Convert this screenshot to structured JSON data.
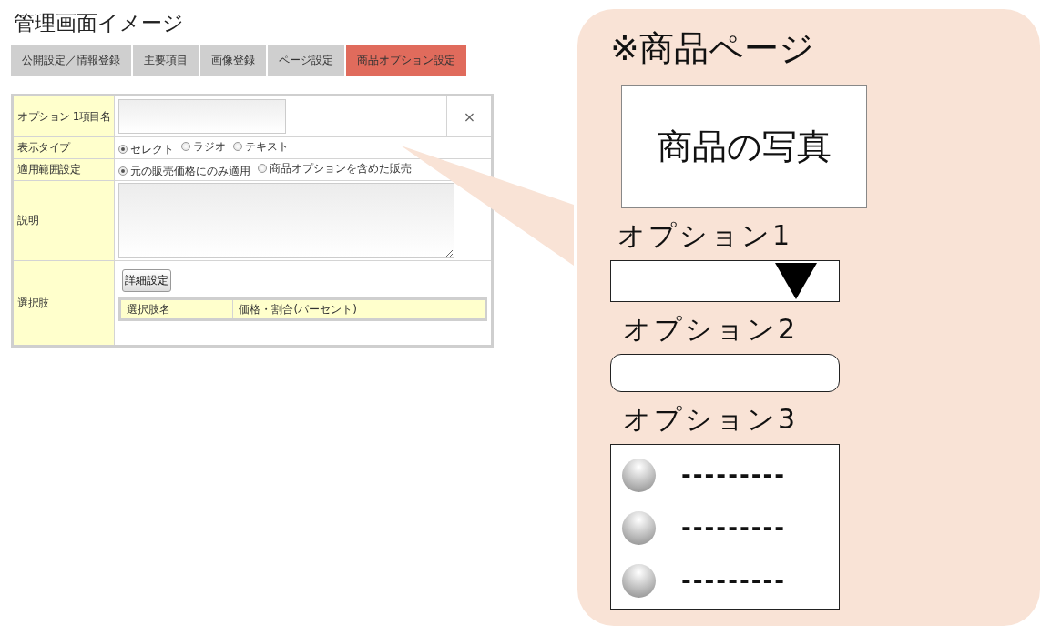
{
  "admin": {
    "title": "管理画面イメージ",
    "tabs": [
      {
        "label": "公開設定／情報登録",
        "selected": false
      },
      {
        "label": "主要項目",
        "selected": false
      },
      {
        "label": "画像登録",
        "selected": false
      },
      {
        "label": "ページ設定",
        "selected": false
      },
      {
        "label": "商品オプション設定",
        "selected": true
      }
    ],
    "rows": [
      {
        "kind": "text",
        "label": "オプション 1項目名",
        "close": "×"
      },
      {
        "kind": "radio",
        "label": "表示タイプ",
        "options": [
          {
            "label": "セレクト",
            "selected": true
          },
          {
            "label": "ラジオ",
            "selected": false
          },
          {
            "label": "テキスト",
            "selected": false
          }
        ]
      },
      {
        "kind": "radio",
        "label": "適用範囲設定",
        "options": [
          {
            "label": "元の販売価格にのみ適用",
            "selected": true
          },
          {
            "label": "商品オプションを含めた販売",
            "selected": false
          }
        ]
      },
      {
        "kind": "textarea",
        "label": "説明"
      },
      {
        "kind": "choices",
        "label": "選択肢",
        "button": "詳細設定",
        "columns": [
          "選択肢名",
          "価格・割合(パーセント)"
        ]
      }
    ]
  },
  "preview": {
    "title": "※商品ページ",
    "photo_label": "商品の写真",
    "options": [
      {
        "label": "オプション1",
        "kind": "select"
      },
      {
        "label": "オプション2",
        "kind": "text"
      },
      {
        "label": "オプション3",
        "kind": "radio",
        "items": [
          {
            "label": "---------",
            "selected": false
          },
          {
            "label": "---------",
            "selected": false
          },
          {
            "label": "---------",
            "selected": false
          }
        ]
      }
    ]
  }
}
